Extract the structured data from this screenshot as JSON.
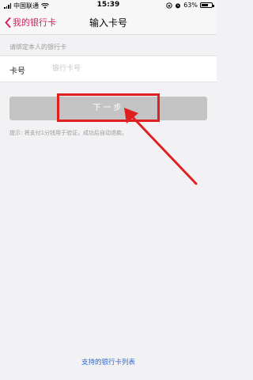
{
  "status_bar": {
    "carrier": "中国联通",
    "time": "15:39",
    "battery": "63%",
    "battery_level": 0.63
  },
  "nav": {
    "back_label": "我的银行卡",
    "title": "输入卡号"
  },
  "form": {
    "section_hint": "请绑定本人的银行卡",
    "card_label": "卡号",
    "card_placeholder": "银行卡号",
    "card_value": ""
  },
  "buttons": {
    "next": "下一步"
  },
  "tip": "提示: 将支付1分钱用于验证，成功后自动退款。",
  "footer_link": "支持的银行卡列表",
  "colors": {
    "accent": "#d81e5b",
    "button_disabled": "#c4c4c4",
    "link": "#2e6bd6",
    "annotation": "#e02020"
  }
}
